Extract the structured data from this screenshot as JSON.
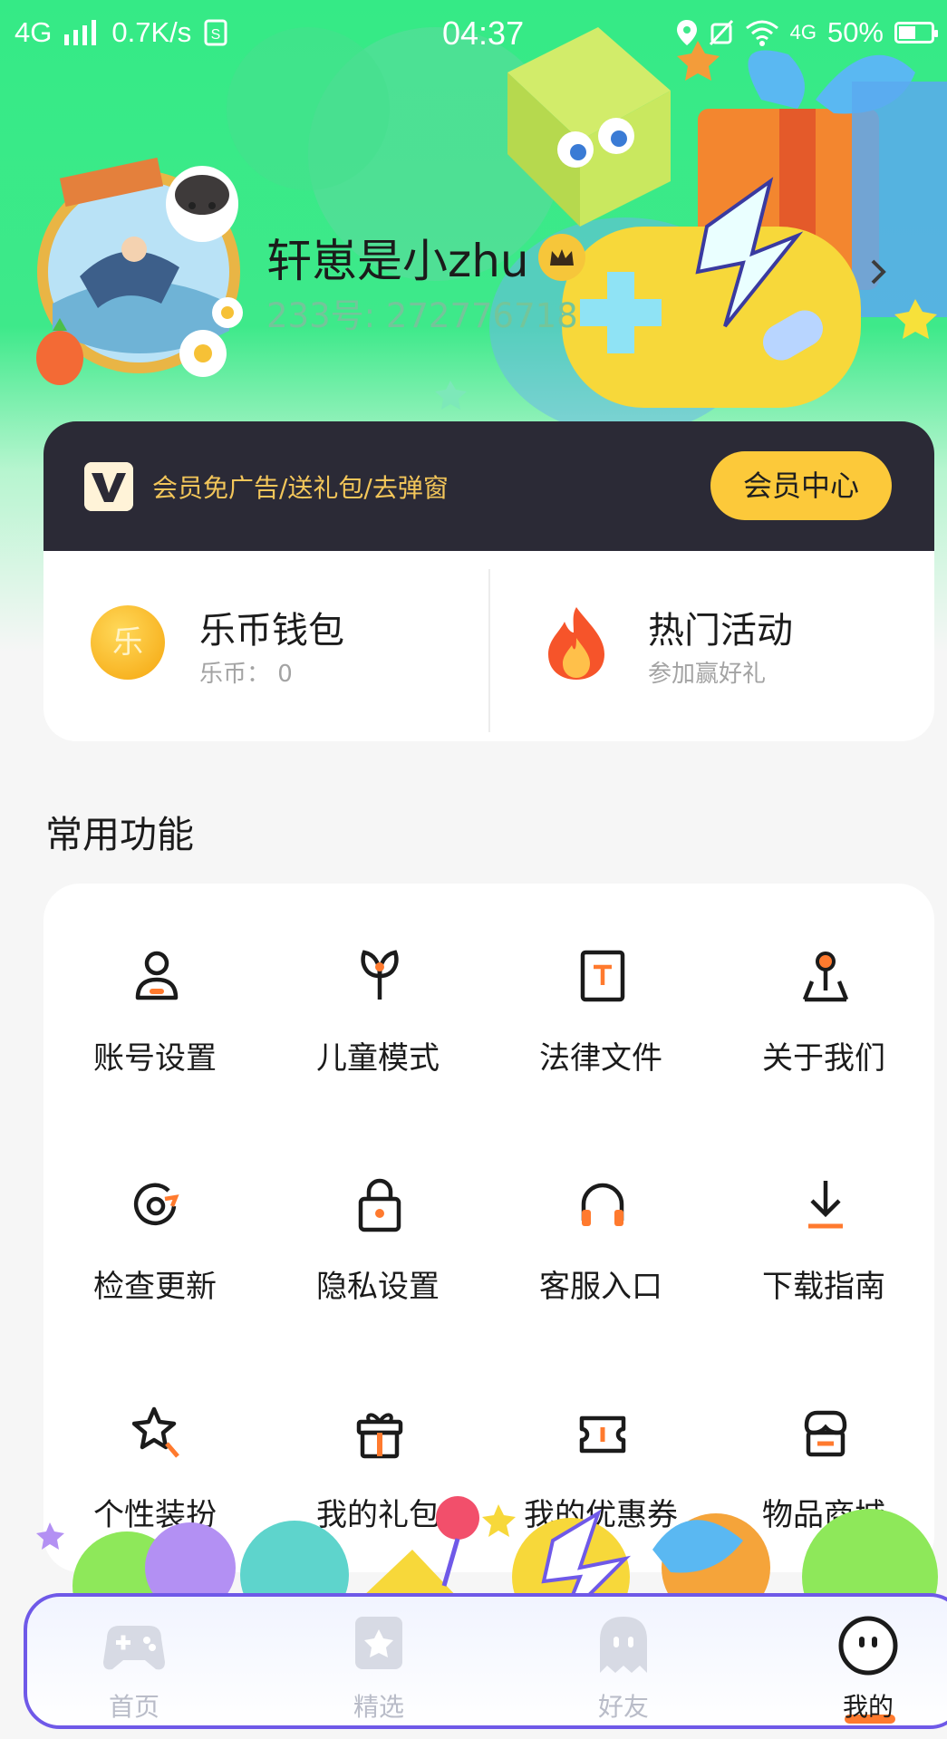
{
  "status_bar": {
    "network": "4G",
    "speed": "0.7K/s",
    "time": "04:37",
    "network_right": "4G",
    "battery": "50%",
    "battery_level": 0.5
  },
  "profile": {
    "username": "轩崽是小zhu",
    "user_id": "233号: 272776718"
  },
  "vip": {
    "promo_text": "会员免广告/送礼包/去弹窗",
    "button_label": "会员中心"
  },
  "wallet": {
    "coin_title": "乐币钱包",
    "coin_sub": "乐币：  0",
    "coin_glyph": "乐",
    "activity_title": "热门活动",
    "activity_sub": "参加赢好礼"
  },
  "functions": {
    "title": "常用功能",
    "items": [
      {
        "label": "账号设置",
        "icon": "user-icon"
      },
      {
        "label": "儿童模式",
        "icon": "sprout-icon"
      },
      {
        "label": "法律文件",
        "icon": "document-icon"
      },
      {
        "label": "关于我们",
        "icon": "joystick-icon"
      },
      {
        "label": "检查更新",
        "icon": "refresh-icon"
      },
      {
        "label": "隐私设置",
        "icon": "lock-icon"
      },
      {
        "label": "客服入口",
        "icon": "headset-icon"
      },
      {
        "label": "下载指南",
        "icon": "download-icon"
      },
      {
        "label": "个性装扮",
        "icon": "star-brush-icon"
      },
      {
        "label": "我的礼包",
        "icon": "gift-icon"
      },
      {
        "label": "我的优惠券",
        "icon": "ticket-icon"
      },
      {
        "label": "物品商城",
        "icon": "shop-icon"
      }
    ]
  },
  "nav": {
    "items": [
      {
        "label": "首页",
        "icon": "gamepad-icon"
      },
      {
        "label": "精选",
        "icon": "featured-icon"
      },
      {
        "label": "好友",
        "icon": "ghost-icon"
      },
      {
        "label": "我的",
        "icon": "face-icon"
      }
    ],
    "active_index": 3
  },
  "colors": {
    "header_green": "#35ea86",
    "accent_orange": "#ff7a2e",
    "vip_dark": "#2b2a36",
    "vip_gold": "#fcc93a"
  }
}
